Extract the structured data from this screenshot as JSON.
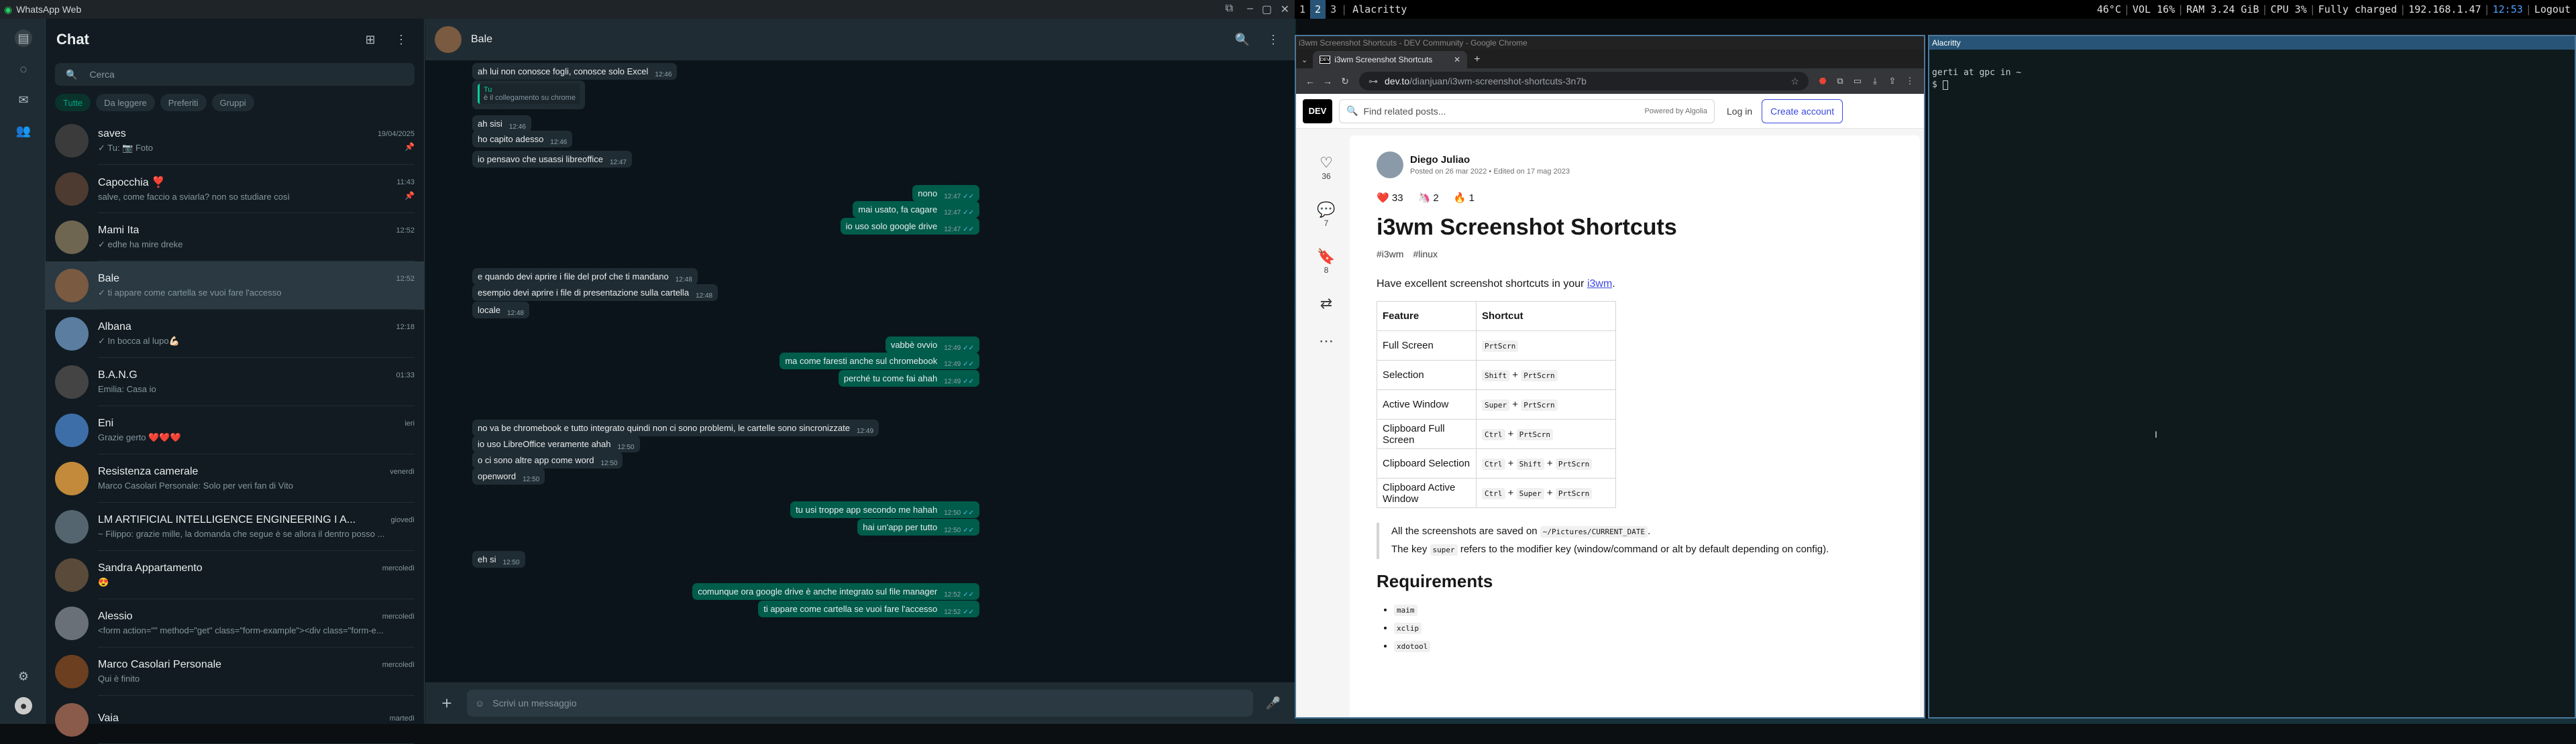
{
  "wa": {
    "window_title": "WhatsApp Web",
    "list_title": "Chat",
    "search_placeholder": "Cerca",
    "filters": [
      "Tutte",
      "Da leggere",
      "Preferiti",
      "Gruppi"
    ],
    "chats": [
      {
        "name": "saves",
        "time": "19/04/2025",
        "preview": "✓ Tu: 📷 Foto",
        "pinned": true,
        "color": "#3b3b3b"
      },
      {
        "name": "Capocchia ❣️",
        "time": "11:43",
        "preview": "salve, come faccio a sviarla? non so studiare così",
        "pinned": true,
        "color": "#4d3a30"
      },
      {
        "name": "Mami Ita",
        "time": "12:52",
        "preview": "✓ edhe ha mire dreke",
        "pinned": false,
        "color": "#6e6650"
      },
      {
        "name": "Bale",
        "time": "12:52",
        "preview": "✓ ti appare come cartella se vuoi fare l'accesso",
        "pinned": false,
        "color": "#7a5a40",
        "selected": true
      },
      {
        "name": "Albana",
        "time": "12:18",
        "preview": "✓ In bocca al lupo💪🏻",
        "pinned": false,
        "color": "#5a7da0"
      },
      {
        "name": "B.A.N.G",
        "time": "01:33",
        "preview": "Emilia: Casa io",
        "pinned": false,
        "color": "#444"
      },
      {
        "name": "Eni",
        "time": "ieri",
        "preview": "Grazie gerto ❤️❤️❤️",
        "pinned": false,
        "color": "#3d6ea8"
      },
      {
        "name": "Resistenza camerale",
        "time": "venerdì",
        "preview": "Marco Casolari Personale: Solo per veri fan di Vito",
        "pinned": false,
        "color": "#c28a3a"
      },
      {
        "name": "LM ARTIFICIAL INTELLIGENCE ENGINEERING I A...",
        "time": "giovedì",
        "preview": "~ Filippo: grazie mille, la domanda che segue è se allora il dentro posso ...",
        "pinned": false,
        "color": "#54656f"
      },
      {
        "name": "Sandra Appartamento",
        "time": "mercoledì",
        "preview": "😍",
        "pinned": false,
        "color": "#5a4a3a"
      },
      {
        "name": "Alessio",
        "time": "mercoledì",
        "preview": "<form action=\"\" method=\"get\" class=\"form-example\"><div class=\"form-e...",
        "pinned": false,
        "color": "#6a7078"
      },
      {
        "name": "Marco Casolari Personale",
        "time": "mercoledì",
        "preview": "Qui è finito",
        "pinned": false,
        "color": "#6b3f20"
      },
      {
        "name": "Vaia",
        "time": "martedì",
        "preview": "",
        "pinned": false,
        "color": "#8a5a4a"
      }
    ],
    "conversation": {
      "name": "Bale",
      "composer_placeholder": "Scrivi un messaggio",
      "messages": [
        {
          "dir": "in",
          "text": "ah lui non conosce fogli, conosce solo Excel",
          "time": "12:46"
        },
        {
          "dir": "in",
          "text": "è il collegamento su chrome",
          "time": "",
          "quote_name": "Tu"
        },
        {
          "dir": "in",
          "text": "ah sisi",
          "time": "12:46"
        },
        {
          "dir": "in",
          "text": "ho capito adesso",
          "time": "12:46"
        },
        {
          "dir": "in",
          "text": "io pensavo che usassi libreoffice",
          "time": "12:47"
        },
        {
          "dir": "out",
          "text": "nono",
          "time": "12:47"
        },
        {
          "dir": "out",
          "text": "mai usato, fa cagare",
          "time": "12:47"
        },
        {
          "dir": "out",
          "text": "io uso solo google drive",
          "time": "12:47"
        },
        {
          "dir": "in",
          "text": "e quando devi aprire i file del prof che ti mandano",
          "time": "12:48"
        },
        {
          "dir": "in",
          "text": "esempio devi aprire i file di presentazione sulla cartella",
          "time": "12:48"
        },
        {
          "dir": "in",
          "text": "locale",
          "time": "12:48"
        },
        {
          "dir": "out",
          "text": "vabbè ovvio",
          "time": "12:49"
        },
        {
          "dir": "out",
          "text": "ma come faresti anche sul chromebook",
          "time": "12:49"
        },
        {
          "dir": "out",
          "text": "perché tu come fai ahah",
          "time": "12:49"
        },
        {
          "dir": "in",
          "text": "no va be chromebook e tutto integrato quindi non ci sono problemi, le cartelle sono sincronizzate",
          "time": "12:49"
        },
        {
          "dir": "in",
          "text": "io uso LibreOffice veramente ahah",
          "time": "12:50"
        },
        {
          "dir": "in",
          "text": "o ci sono altre app come word",
          "time": "12:50"
        },
        {
          "dir": "in",
          "text": "openword",
          "time": "12:50"
        },
        {
          "dir": "out",
          "text": "tu usi troppe app secondo me hahah",
          "time": "12:50"
        },
        {
          "dir": "out",
          "text": "hai un'app per tutto",
          "time": "12:50"
        },
        {
          "dir": "in",
          "text": "eh si",
          "time": "12:50"
        },
        {
          "dir": "out",
          "text": "comunque ora google drive è anche integrato sul file manager",
          "time": "12:52"
        },
        {
          "dir": "out",
          "text": "ti appare come cartella se vuoi fare l'accesso",
          "time": "12:52"
        }
      ]
    }
  },
  "i3bar": {
    "workspaces": [
      "1",
      "2",
      "3"
    ],
    "focused_workspace": "2",
    "window_title": "Alacritty",
    "status": [
      "46°C",
      "VOL  16%",
      "RAM 3.24 GiB",
      "CPU   3%",
      "Fully charged",
      "192.168.1.47",
      "12:53",
      "Logout"
    ]
  },
  "chrome": {
    "window_title": "i3wm Screenshot Shortcuts - DEV Community - Google Chrome",
    "tab_title": "i3wm Screenshot Shortcuts",
    "url_host": "dev.to",
    "url_path": "/dianjuan/i3wm-screenshot-shortcuts-3n7b",
    "page": {
      "logo": "DEV",
      "search_placeholder": "Find related posts...",
      "powered_by": "Powered by Algolia",
      "login": "Log in",
      "create_account": "Create account",
      "side_counts": [
        "36",
        "7",
        "8"
      ],
      "author": "Diego Juliao",
      "dates": "Posted on 26 mar 2022 • Edited on 17 mag 2023",
      "reactions": [
        "33",
        "2",
        "1"
      ],
      "title": "i3wm Screenshot Shortcuts",
      "tags": [
        "#i3wm",
        "#linux"
      ],
      "intro": "Have excellent screenshot shortcuts in your",
      "intro_link": "i3wm",
      "table_headers": [
        "Feature",
        "Shortcut"
      ],
      "table_rows": [
        {
          "feature": "Full Screen",
          "keys": [
            "PrtScrn"
          ]
        },
        {
          "feature": "Selection",
          "keys": [
            "Shift",
            "PrtScrn"
          ]
        },
        {
          "feature": "Active Window",
          "keys": [
            "Super",
            "PrtScrn"
          ]
        },
        {
          "feature": "Clipboard Full Screen",
          "keys": [
            "Ctrl",
            "PrtScrn"
          ]
        },
        {
          "feature": "Clipboard Selection",
          "keys": [
            "Ctrl",
            "Shift",
            "PrtScrn"
          ]
        },
        {
          "feature": "Clipboard Active Window",
          "keys": [
            "Ctrl",
            "Super",
            "PrtScrn"
          ]
        }
      ],
      "note1_a": "All the screenshots are saved on",
      "note1_code": "~/Pictures/CURRENT_DATE",
      "note2_a": "The key",
      "note2_code": "super",
      "note2_b": "refers to the modifier key (window/command or alt by default depending on config).",
      "requirements_heading": "Requirements",
      "requirements": [
        "maim",
        "xclip",
        "xdotool"
      ]
    }
  },
  "alacritty": {
    "title": "Alacritty",
    "prompt_line1": "gerti at gpc in ~",
    "prompt_line2": "$ "
  }
}
